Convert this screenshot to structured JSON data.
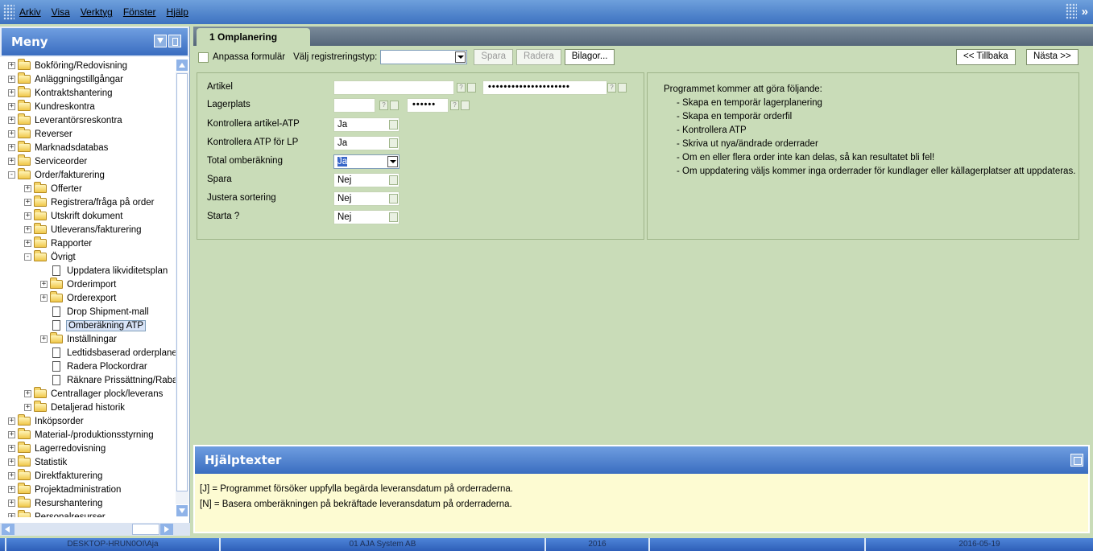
{
  "menubar": {
    "items": [
      "Arkiv",
      "Visa",
      "Verktyg",
      "Fönster",
      "Hjälp"
    ]
  },
  "sidebar": {
    "title": "Meny",
    "tree": [
      {
        "label": "Bokföring/Redovisning",
        "level": 0,
        "kind": "folder",
        "exp": "+"
      },
      {
        "label": "Anläggningstillgångar",
        "level": 0,
        "kind": "folder",
        "exp": "+"
      },
      {
        "label": "Kontraktshantering",
        "level": 0,
        "kind": "folder",
        "exp": "+"
      },
      {
        "label": "Kundreskontra",
        "level": 0,
        "kind": "folder",
        "exp": "+"
      },
      {
        "label": "Leverantörsreskontra",
        "level": 0,
        "kind": "folder",
        "exp": "+"
      },
      {
        "label": "Reverser",
        "level": 0,
        "kind": "folder",
        "exp": "+"
      },
      {
        "label": "Marknadsdatabas",
        "level": 0,
        "kind": "folder",
        "exp": "+"
      },
      {
        "label": "Serviceorder",
        "level": 0,
        "kind": "folder",
        "exp": "+"
      },
      {
        "label": "Order/fakturering",
        "level": 0,
        "kind": "folder",
        "exp": "-"
      },
      {
        "label": "Offerter",
        "level": 1,
        "kind": "folder",
        "exp": "+"
      },
      {
        "label": "Registrera/fråga på order",
        "level": 1,
        "kind": "folder",
        "exp": "+"
      },
      {
        "label": "Utskrift dokument",
        "level": 1,
        "kind": "folder",
        "exp": "+"
      },
      {
        "label": "Utleverans/fakturering",
        "level": 1,
        "kind": "folder",
        "exp": "+"
      },
      {
        "label": "Rapporter",
        "level": 1,
        "kind": "folder",
        "exp": "+"
      },
      {
        "label": "Övrigt",
        "level": 1,
        "kind": "folder",
        "exp": "-"
      },
      {
        "label": "Uppdatera likviditetsplan",
        "level": 2,
        "kind": "doc",
        "exp": ""
      },
      {
        "label": "Orderimport",
        "level": 2,
        "kind": "folder",
        "exp": "+"
      },
      {
        "label": "Orderexport",
        "level": 2,
        "kind": "folder",
        "exp": "+"
      },
      {
        "label": "Drop Shipment-mall",
        "level": 2,
        "kind": "doc",
        "exp": ""
      },
      {
        "label": "Omberäkning ATP",
        "level": 2,
        "kind": "doc",
        "exp": "",
        "selected": true
      },
      {
        "label": "Inställningar",
        "level": 2,
        "kind": "folder",
        "exp": "+"
      },
      {
        "label": "Ledtidsbaserad orderplanering",
        "level": 2,
        "kind": "doc",
        "exp": ""
      },
      {
        "label": "Radera Plockordrar",
        "level": 2,
        "kind": "doc",
        "exp": ""
      },
      {
        "label": "Räknare Prissättning/Rabatter",
        "level": 2,
        "kind": "doc",
        "exp": ""
      },
      {
        "label": "Centrallager plock/leverans",
        "level": 1,
        "kind": "folder",
        "exp": "+"
      },
      {
        "label": "Detaljerad historik",
        "level": 1,
        "kind": "folder",
        "exp": "+"
      },
      {
        "label": "Inköpsorder",
        "level": 0,
        "kind": "folder",
        "exp": "+"
      },
      {
        "label": "Material-/produktionsstyrning",
        "level": 0,
        "kind": "folder",
        "exp": "+"
      },
      {
        "label": "Lagerredovisning",
        "level": 0,
        "kind": "folder",
        "exp": "+"
      },
      {
        "label": "Statistik",
        "level": 0,
        "kind": "folder",
        "exp": "+"
      },
      {
        "label": "Direktfakturering",
        "level": 0,
        "kind": "folder",
        "exp": "+"
      },
      {
        "label": "Projektadministration",
        "level": 0,
        "kind": "folder",
        "exp": "+"
      },
      {
        "label": "Resurshantering",
        "level": 0,
        "kind": "folder",
        "exp": "+"
      },
      {
        "label": "Personalresurser",
        "level": 0,
        "kind": "folder",
        "exp": "+"
      }
    ]
  },
  "tab": {
    "label": "1 Omplanering"
  },
  "toolbar": {
    "customize_label": "Anpassa formulär",
    "regtype_label": "Välj registreringstyp:",
    "regtype_value": "",
    "save_label": "Spara",
    "delete_label": "Radera",
    "attach_label": "Bilagor...",
    "back_label": "<< Tillbaka",
    "next_label": "Nästa >>"
  },
  "form": {
    "artikel_label": "Artikel",
    "artikel_value": "",
    "artikel_masked": "•••••••••••••••••••••",
    "lagerplats_label": "Lagerplats",
    "lagerplats_value": "",
    "lagerplats_masked": "••••••",
    "kontrollera_atp_label": "Kontrollera artikel-ATP",
    "kontrollera_atp_value": "Ja",
    "kontrollera_lp_label": "Kontrollera ATP för LP",
    "kontrollera_lp_value": "Ja",
    "total_label": "Total omberäkning",
    "total_value": "Ja",
    "spara_label": "Spara",
    "spara_value": "Nej",
    "justera_label": "Justera sortering",
    "justera_value": "Nej",
    "starta_label": "Starta ?",
    "starta_value": "Nej",
    "help_glyph": "?"
  },
  "info": {
    "heading": "Programmet kommer att göra följande:",
    "items": [
      "- Skapa en temporär lagerplanering",
      "- Skapa en temporär orderfil",
      "- Kontrollera ATP",
      "- Skriva ut nya/ändrade orderrader",
      "- Om en eller flera order inte kan delas, så kan resultatet bli fel!",
      "- Om uppdatering väljs kommer inga orderrader för kundlager eller källagerplatser att uppdateras."
    ]
  },
  "help": {
    "title": "Hjälptexter",
    "lines": [
      "[J] = Programmet försöker uppfylla begärda leveransdatum på orderraderna.",
      "[N] = Basera omberäkningen på bekräftade leveransdatum på orderraderna."
    ]
  },
  "status": {
    "user": "DESKTOP-HRUN0OI\\Aja",
    "company": "01 AJA System AB",
    "year": "2016",
    "empty": "",
    "date": "2016-05-19"
  },
  "colors": {
    "accent": "#3a6dc0",
    "form_bg": "#c9dcb8",
    "help_bg": "#fdfbd2"
  }
}
